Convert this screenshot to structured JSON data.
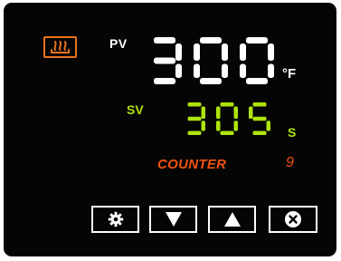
{
  "controller": {
    "heat_indicator_icon": "heat-waves-icon",
    "accent_colors": {
      "heat": "#e8731c",
      "pv": "#ffffff",
      "sv": "#aee30c",
      "mode": "#f0520f"
    },
    "pv": {
      "label": "PV",
      "value": "300",
      "unit": "°F"
    },
    "sv": {
      "label": "SV",
      "value": "305",
      "unit": "S"
    },
    "mode": {
      "label": "COUNTER",
      "value": "9"
    },
    "buttons": [
      {
        "name": "settings",
        "icon": "gear-icon"
      },
      {
        "name": "down",
        "icon": "triangle-down-icon"
      },
      {
        "name": "up",
        "icon": "triangle-up-icon"
      },
      {
        "name": "close",
        "icon": "close-circle-icon"
      }
    ]
  }
}
